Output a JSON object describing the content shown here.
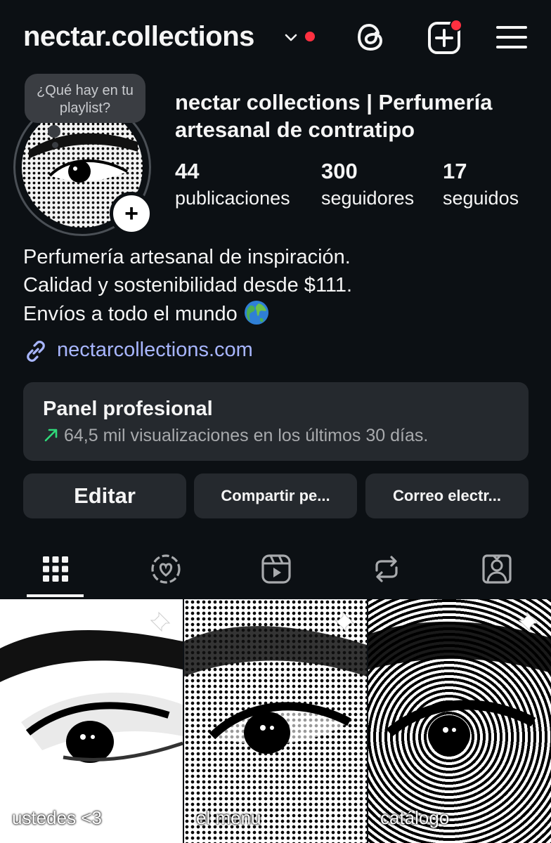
{
  "header": {
    "username": "nectar.collections",
    "has_notification_dot": true,
    "threads_icon": "threads-icon",
    "create_icon": "plus-square-icon",
    "menu_icon": "hamburger-menu-icon",
    "accent_red": "#ff3040"
  },
  "profile": {
    "note": "¿Qué hay en tu playlist?",
    "full_name": "nectar collections | Perfumería artesanal de contratipo",
    "stats": [
      {
        "value": "44",
        "label": "publicaciones"
      },
      {
        "value": "300",
        "label": "seguidores"
      },
      {
        "value": "17",
        "label": "seguidos"
      }
    ],
    "bio": [
      "Perfumería artesanal de inspiración.",
      "Calidad y sostenibilidad desde $111.",
      "Envíos a todo el mundo"
    ],
    "link": "nectarcollections.com",
    "link_color": "#a8b6ff"
  },
  "panel": {
    "title": "Panel profesional",
    "subtitle": "64,5 mil visualizaciones en los últimos 30 días.",
    "trend_color": "#2fd97a"
  },
  "actions": {
    "edit": "Editar",
    "share": "Compartir pe...",
    "email": "Correo electr..."
  },
  "tabs": [
    {
      "icon": "grid-icon",
      "active": true
    },
    {
      "icon": "collab-heart-icon",
      "active": false
    },
    {
      "icon": "reels-icon",
      "active": false
    },
    {
      "icon": "repost-icon",
      "active": false
    },
    {
      "icon": "tagged-user-icon",
      "active": false
    }
  ],
  "posts": [
    {
      "caption": "ustedes <3",
      "pinned": true
    },
    {
      "caption": "el menu",
      "pinned": true
    },
    {
      "caption": "catálogo",
      "pinned": true
    }
  ]
}
